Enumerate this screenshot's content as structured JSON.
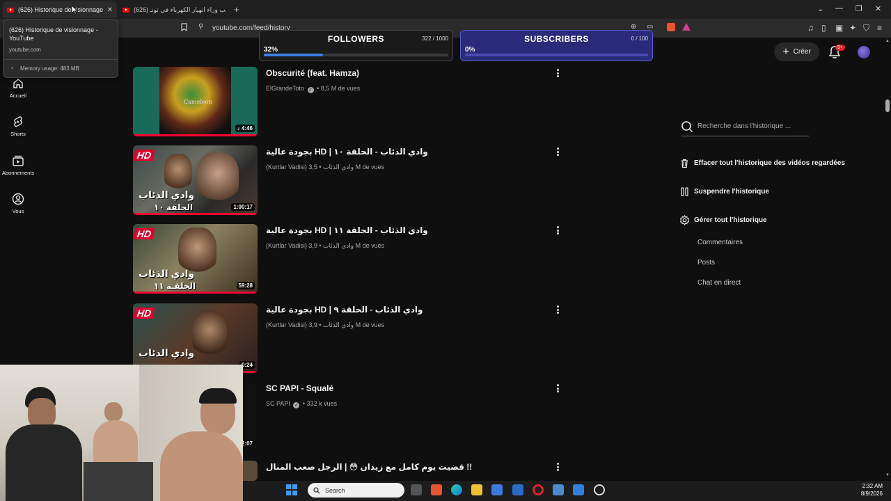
{
  "browser": {
    "active_tab": {
      "title": "(626) Historique de visionnage -"
    },
    "inactive_tab": {
      "title": "(626) السبب وراء انهيار الكهرباء في تونـ"
    },
    "url": "youtube.com/feed/history",
    "tooltip": {
      "title": "(626) Historique de visionnage - YouTube",
      "domain": "youtube.com",
      "memory": "Memory usage: 483 MB"
    }
  },
  "overlays": {
    "followers": {
      "title": "FOLLOWERS",
      "count": "322 / 1000",
      "percent_label": "32%",
      "progress": 0.32,
      "color": "#3d7ee6"
    },
    "subscribers": {
      "title": "SUBSCRIBERS",
      "count": "0 / 100",
      "percent_label": "0%",
      "progress": 0.0,
      "color": "#2a2a7a"
    }
  },
  "sidebar": {
    "items": [
      {
        "label": "Accueil",
        "icon": "home-icon"
      },
      {
        "label": "Shorts",
        "icon": "shorts-icon"
      },
      {
        "label": "Abonnements",
        "icon": "subscriptions-icon"
      },
      {
        "label": "Vous",
        "icon": "account-icon"
      }
    ]
  },
  "header": {
    "create_label": "Créer",
    "notification_badge": "9+"
  },
  "videos": [
    {
      "title": "Obscurité (feat. Hamza)",
      "channel": "ElGrandeToto",
      "verified": true,
      "views": "8,5 M de vues",
      "duration": "4:46",
      "thumb_text": "Cameleon"
    },
    {
      "title": "بجودة عالية HD | وادي الذئاب - الحلقة ١٠",
      "channel": "(Kurtlar Vadisi) وادي الذئاب",
      "verified": false,
      "views": "3,5 M de vues",
      "duration": "1:00:17",
      "hd": "HD",
      "ar_title": "وادي الذئاب",
      "ar_ep": "الحلقة ١٠"
    },
    {
      "title": "بجودة عالية HD | وادي الذئاب - الحلقة ١١",
      "channel": "(Kurtlar Vadisi) وادي الذئاب",
      "verified": false,
      "views": "3,9 M de vues",
      "duration": "59:28",
      "hd": "HD",
      "ar_title": "وادي الذئاب",
      "ar_ep": "الحلقـة ١١"
    },
    {
      "title": "بجودة عالية HD | وادي الذئاب - الحلقة ٩",
      "channel": "(Kurtlar Vadisi) وادي الذئاب",
      "verified": false,
      "views": "3,9 M de vues",
      "duration": "0:24",
      "hd": "HD",
      "ar_title": "وادي الذئاب"
    },
    {
      "title": "SC PAPI - Squalé",
      "channel": "SC PAPI",
      "verified": true,
      "views": "332 k vues",
      "duration": "2:07"
    },
    {
      "title": "قضيت يوم كامل مع زيدان 😳 | الرجل صعب المنال !!"
    }
  ],
  "right_panel": {
    "search_placeholder": "Recherche dans l'historique ...",
    "clear_all": "Effacer tout l'historique des vidéos regardées",
    "pause": "Suspendre l'historique",
    "manage": "Gérer tout l'historique",
    "sub_items": [
      "Commentaires",
      "Posts",
      "Chat en direct"
    ]
  },
  "taskbar": {
    "search_label": "Search",
    "time": "2:32 AM",
    "date": "8/9/2026"
  }
}
